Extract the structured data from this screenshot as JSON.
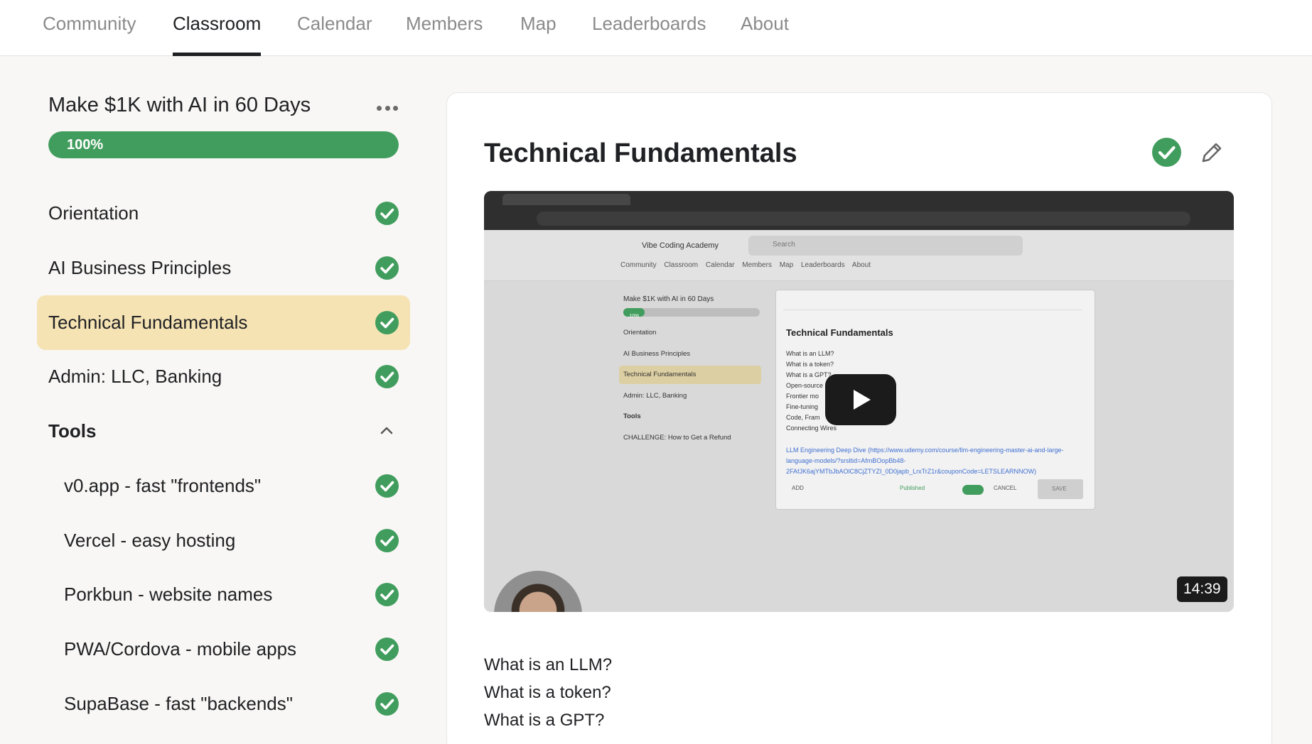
{
  "nav": {
    "tabs": [
      {
        "label": "Community"
      },
      {
        "label": "Classroom"
      },
      {
        "label": "Calendar"
      },
      {
        "label": "Members"
      },
      {
        "label": "Map"
      },
      {
        "label": "Leaderboards"
      },
      {
        "label": "About"
      }
    ],
    "active_tab": "Classroom"
  },
  "sidebar": {
    "course_title": "Make $1K with AI in 60 Days",
    "progress_label": "100%",
    "progress_fraction": 1.0,
    "items": [
      {
        "label": "Orientation",
        "completed": true
      },
      {
        "label": "AI Business Principles",
        "completed": true
      },
      {
        "label": "Technical Fundamentals",
        "completed": true,
        "selected": true
      },
      {
        "label": "Admin: LLC, Banking",
        "completed": true
      }
    ],
    "group": {
      "label": "Tools",
      "expanded": true,
      "items": [
        {
          "label": "v0.app - fast \"frontends\"",
          "completed": true
        },
        {
          "label": "Vercel - easy hosting",
          "completed": true
        },
        {
          "label": "Porkbun - website names",
          "completed": true
        },
        {
          "label": "PWA/Cordova - mobile apps",
          "completed": true
        },
        {
          "label": "SupaBase - fast \"backends\"",
          "completed": true
        }
      ]
    }
  },
  "lesson": {
    "title": "Technical Fundamentals",
    "video": {
      "duration": "14:39",
      "inner": {
        "brand": "Vibe Coding Academy",
        "search_placeholder": "Search",
        "nav": "Community Classroom Calendar Members Map Leaderboards About",
        "course_title": "Make $1K with AI in 60 Days",
        "progress_label": "10%",
        "rows": [
          "Orientation",
          "AI Business Principles",
          "Technical Fundamentals",
          "Admin: LLC, Banking",
          "Tools",
          "CHALLENGE: How to Get a Refund"
        ],
        "editor_title": "Technical Fundamentals",
        "editor_lines": [
          "What is an LLM?",
          "What is a token?",
          "What is a GPT?",
          "Open-source",
          "Frontier mo",
          "Fine-tuning",
          "Code, Fram",
          "Connecting Wires"
        ],
        "editor_link": "LLM Engineering Deep Dive (https://www.udemy.com/course/llm-engineering-master-ai-and-large-language-models/?srsltid=AfmBOopBb48-2FAfJK6ajYMTbJbAOlC8CjZTYZI_0D0japb_LrxTrZ1r&couponCode=LETSLEARNNOW)",
        "published_label": "Published",
        "cancel_label": "CANCEL",
        "save_label": "SAVE",
        "add_label": "ADD"
      }
    },
    "description_lines": [
      "What is an LLM?",
      "What is a token?",
      "What is a GPT?"
    ]
  },
  "colors": {
    "accent_green": "#419d5d",
    "selected_bg": "#f5e3b4",
    "page_bg": "#f8f7f5"
  }
}
